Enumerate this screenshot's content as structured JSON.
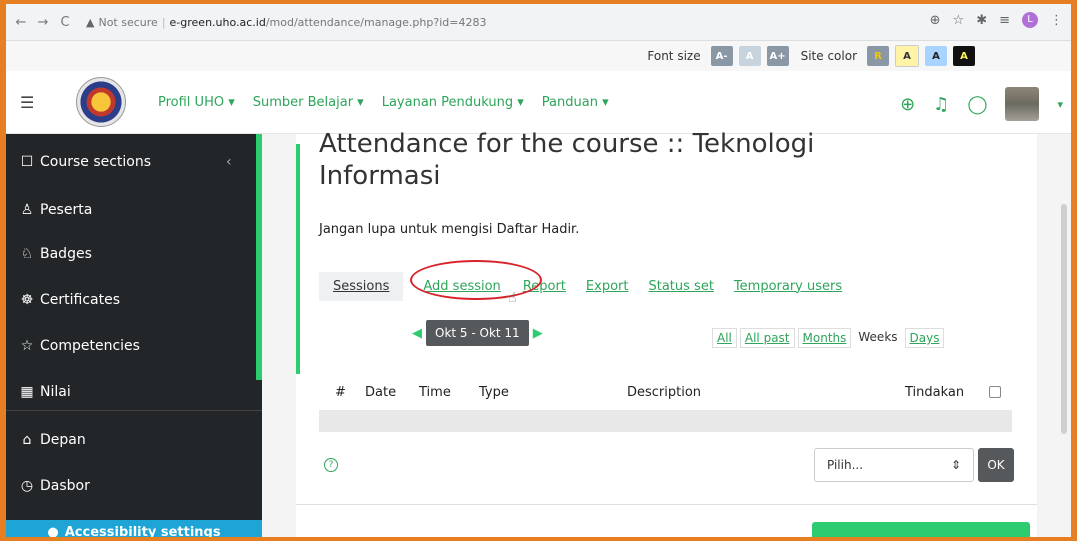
{
  "browser": {
    "warning": "▲",
    "not_secure": "Not secure",
    "url_host": "e-green.uho.ac.id",
    "url_path": "/mod/attendance/manage.php?id=4283"
  },
  "accessibility": {
    "font_size_label": "Font size",
    "decrease": "A-",
    "default": "A",
    "increase": "A+",
    "site_color_label": "Site color",
    "colors": [
      "R",
      "A",
      "A",
      "A"
    ]
  },
  "navbar": {
    "menu": [
      "Profil UHO ▾",
      "Sumber Belajar ▾",
      "Layanan Pendukung ▾",
      "Panduan ▾"
    ]
  },
  "sidebar": {
    "items": [
      {
        "icon": "☐",
        "label": "Course sections"
      },
      {
        "icon": "♙",
        "label": "Peserta"
      },
      {
        "icon": "♘",
        "label": "Badges"
      },
      {
        "icon": "☸",
        "label": "Certificates"
      },
      {
        "icon": "☆",
        "label": "Competencies"
      },
      {
        "icon": "▦",
        "label": "Nilai"
      },
      {
        "icon": "⌂",
        "label": "Depan"
      },
      {
        "icon": "◷",
        "label": "Dasbor"
      }
    ],
    "collapse": "‹",
    "accessibility_settings": "Accessibility settings"
  },
  "main": {
    "title": "Attendance for the course :: Teknologi Informasi",
    "description": "Jangan lupa untuk mengisi Daftar Hadir.",
    "tabs": [
      "Sessions",
      "Add session",
      "Report",
      "Export",
      "Status set",
      "Temporary users"
    ],
    "pager": {
      "prev": "◀",
      "range": "Okt 5 - Okt 11",
      "next": "▶"
    },
    "views": [
      "All",
      "All past",
      "Months",
      "Weeks",
      "Days"
    ],
    "columns": [
      "#",
      "Date",
      "Time",
      "Type",
      "Description",
      "Tindakan"
    ],
    "help": "?",
    "select_value": "Pilih...",
    "ok": "OK"
  }
}
